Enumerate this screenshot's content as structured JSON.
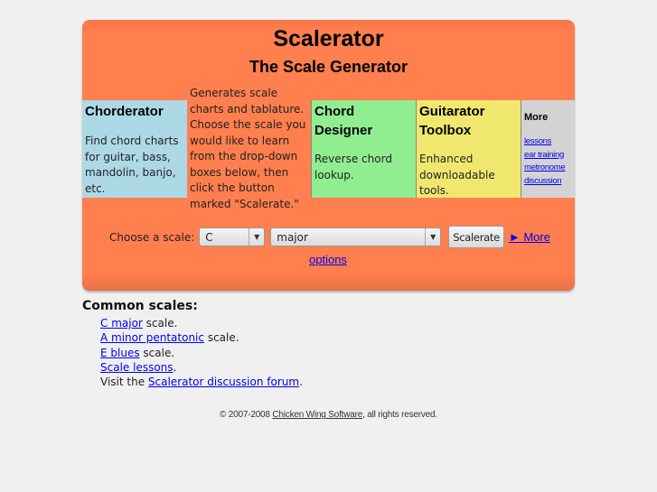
{
  "header": {
    "title": "Scalerator",
    "subtitle": "The Scale Generator"
  },
  "boxes": {
    "chorderator": {
      "title": "Chorderator",
      "desc": "Find chord charts for guitar, bass, mandolin, banjo, etc.",
      "color": "#add8e6"
    },
    "intro": {
      "text": "Generates scale charts and tablature. Choose the scale you would like to learn from the drop-down boxes below, then click the button marked \"Scalerate.\""
    },
    "chord_designer": {
      "title": "Chord Designer",
      "desc": "Reverse chord lookup.",
      "color": "#90ee90"
    },
    "toolbox": {
      "title": "Guitarator Toolbox",
      "desc": "Enhanced downloadable tools.",
      "color": "#f0e86e"
    },
    "more": {
      "title": "More",
      "links": [
        "lessons",
        "ear training",
        "metronome",
        "discussion"
      ]
    }
  },
  "form": {
    "label": "Choose a scale:",
    "key_select": "C",
    "scale_select": "major",
    "submit_label": "Scalerate",
    "more_options_1": "► More",
    "more_options_2": "options"
  },
  "common": {
    "heading": "Common scales:",
    "items": [
      {
        "link": "C major",
        "suffix": " scale."
      },
      {
        "link": "A minor pentatonic",
        "suffix": " scale."
      },
      {
        "link": "E blues",
        "suffix": " scale."
      },
      {
        "link": "Scale lessons",
        "suffix": "."
      }
    ],
    "forum_prefix": "Visit the ",
    "forum_link": "Scalerator discussion forum",
    "forum_suffix": "."
  },
  "footer": {
    "prefix": "© 2007-2008 ",
    "link": "Chicken Wing Software",
    "suffix": ", all rights reserved."
  },
  "colors": {
    "panel": "#ff7f4f",
    "link": "#0000ee"
  }
}
